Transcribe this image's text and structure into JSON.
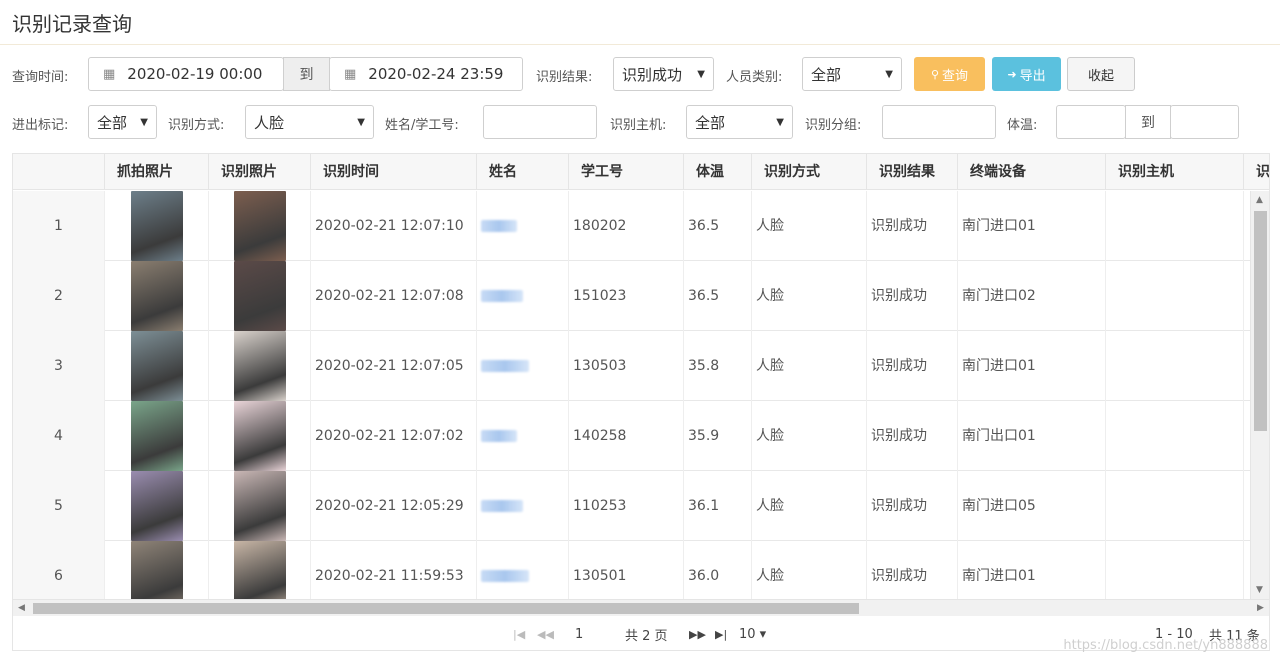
{
  "page": {
    "title": "识别记录查询"
  },
  "filters": {
    "time_label": "查询时间:",
    "date_from": "2020-02-19 00:00",
    "to_label": "到",
    "date_to": "2020-02-24 23:59",
    "result_label": "识别结果:",
    "result_value": "识别成功",
    "person_type_label": "人员类别:",
    "person_type_value": "全部",
    "query_button": "查询",
    "export_button": "导出",
    "collapse_button": "收起",
    "inout_label": "进出标记:",
    "inout_value": "全部",
    "method_label": "识别方式:",
    "method_value": "人脸",
    "name_label": "姓名/学工号:",
    "name_value": "",
    "host_label": "识别主机:",
    "host_value": "全部",
    "group_label": "识别分组:",
    "group_value": "",
    "temp_label": "体温:",
    "temp_from": "",
    "temp_to_label": "到",
    "temp_to": ""
  },
  "table": {
    "columns": [
      "",
      "抓拍照片",
      "识别照片",
      "识别时间",
      "姓名",
      "学工号",
      "体温",
      "识别方式",
      "识别结果",
      "终端设备",
      "识别主机",
      "识"
    ],
    "rows": [
      {
        "idx": "1",
        "time": "2020-02-21 12:07:10",
        "id": "180202",
        "temp": "36.5",
        "method": "人脸",
        "result": "识别成功",
        "device": "南门进口01",
        "host": ""
      },
      {
        "idx": "2",
        "time": "2020-02-21 12:07:08",
        "id": "151023",
        "temp": "36.5",
        "method": "人脸",
        "result": "识别成功",
        "device": "南门进口02",
        "host": ""
      },
      {
        "idx": "3",
        "time": "2020-02-21 12:07:05",
        "id": "130503",
        "temp": "35.8",
        "method": "人脸",
        "result": "识别成功",
        "device": "南门进口01",
        "host": ""
      },
      {
        "idx": "4",
        "time": "2020-02-21 12:07:02",
        "id": "140258",
        "temp": "35.9",
        "method": "人脸",
        "result": "识别成功",
        "device": "南门出口01",
        "host": ""
      },
      {
        "idx": "5",
        "time": "2020-02-21 12:05:29",
        "id": "110253",
        "temp": "36.1",
        "method": "人脸",
        "result": "识别成功",
        "device": "南门进口05",
        "host": ""
      },
      {
        "idx": "6",
        "time": "2020-02-21 11:59:53",
        "id": "130501",
        "temp": "36.0",
        "method": "人脸",
        "result": "识别成功",
        "device": "南门进口01",
        "host": ""
      }
    ]
  },
  "pager": {
    "page_input": "1",
    "total_pages": "共 2 页",
    "page_size": "10 ▾",
    "range": "1 - 10",
    "total_items": "共 11 条"
  },
  "watermark": "https://blog.csdn.net/yn888888",
  "colors": {
    "query": "#f9bf5e",
    "export": "#5bc1de"
  }
}
